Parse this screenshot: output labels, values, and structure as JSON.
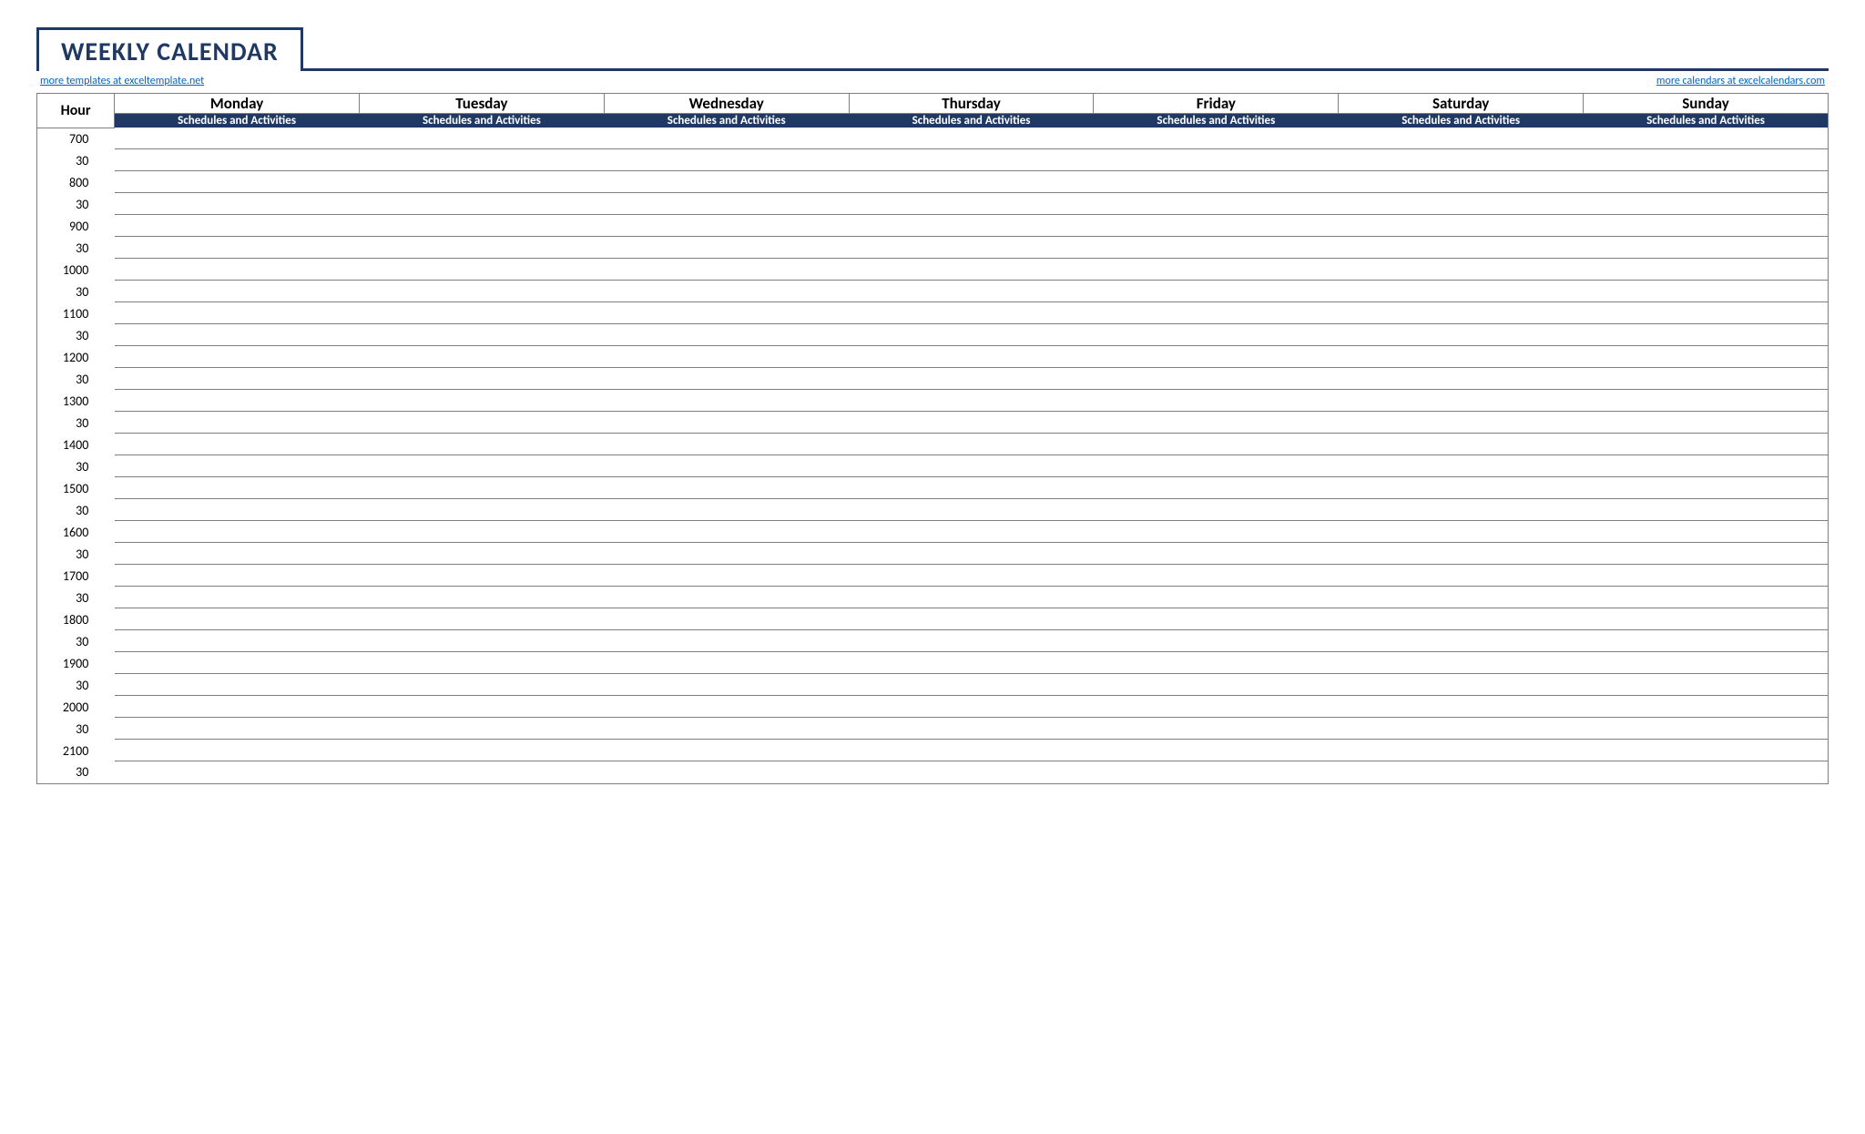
{
  "title": "WEEKLY CALENDAR",
  "links": {
    "left": "more templates at exceltemplate.net",
    "right": "more calendars at excelcalendars.com"
  },
  "header": {
    "hour_label": "Hour",
    "days": [
      "Monday",
      "Tuesday",
      "Wednesday",
      "Thursday",
      "Friday",
      "Saturday",
      "Sunday"
    ],
    "sub_label": "Schedules and Activities"
  },
  "time_slots": [
    {
      "hour": "7",
      "min": "00"
    },
    {
      "hour": "",
      "min": "30"
    },
    {
      "hour": "8",
      "min": "00"
    },
    {
      "hour": "",
      "min": "30"
    },
    {
      "hour": "9",
      "min": "00"
    },
    {
      "hour": "",
      "min": "30"
    },
    {
      "hour": "10",
      "min": "00"
    },
    {
      "hour": "",
      "min": "30"
    },
    {
      "hour": "11",
      "min": "00"
    },
    {
      "hour": "",
      "min": "30"
    },
    {
      "hour": "12",
      "min": "00"
    },
    {
      "hour": "",
      "min": "30"
    },
    {
      "hour": "13",
      "min": "00"
    },
    {
      "hour": "",
      "min": "30"
    },
    {
      "hour": "14",
      "min": "00"
    },
    {
      "hour": "",
      "min": "30"
    },
    {
      "hour": "15",
      "min": "00"
    },
    {
      "hour": "",
      "min": "30"
    },
    {
      "hour": "16",
      "min": "00"
    },
    {
      "hour": "",
      "min": "30"
    },
    {
      "hour": "17",
      "min": "00"
    },
    {
      "hour": "",
      "min": "30"
    },
    {
      "hour": "18",
      "min": "00"
    },
    {
      "hour": "",
      "min": "30"
    },
    {
      "hour": "19",
      "min": "00"
    },
    {
      "hour": "",
      "min": "30"
    },
    {
      "hour": "20",
      "min": "00"
    },
    {
      "hour": "",
      "min": "30"
    },
    {
      "hour": "21",
      "min": "00"
    },
    {
      "hour": "",
      "min": "30"
    }
  ]
}
